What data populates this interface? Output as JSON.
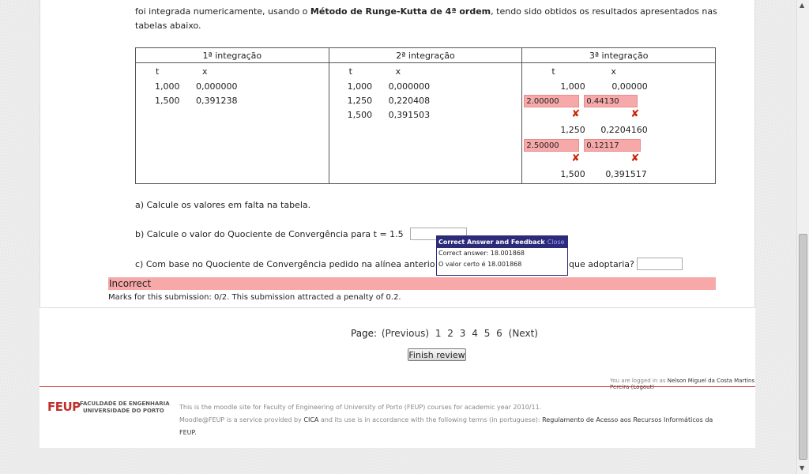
{
  "intro": {
    "part1": "foi integrada numericamente, usando o ",
    "method": "Método de Runge-Kutta de 4ª ordem",
    "part2": ", tendo sido obtidos os resultados apresentados nas",
    "line2": "tabelas abaixo."
  },
  "table": {
    "headers": [
      "1ª integração",
      "2ª integração",
      "3ª integração"
    ],
    "col_t": "t",
    "col_x": "x",
    "int1": [
      [
        "1,000",
        "0,000000"
      ],
      [
        "1,500",
        "0,391238"
      ]
    ],
    "int2": [
      [
        "1,000",
        "0,000000"
      ],
      [
        "1,250",
        "0,220408"
      ],
      [
        "1,500",
        "0,391503"
      ]
    ],
    "int3": {
      "row1": [
        "1,000",
        "0,00000"
      ],
      "input1": [
        "2.00000",
        "0.44130"
      ],
      "row2": [
        "1,250",
        "0,2204160"
      ],
      "input2": [
        "2.50000",
        "0.12117"
      ],
      "row3": [
        "1,500",
        "0,391517"
      ],
      "mark": "✘"
    }
  },
  "questions": {
    "a": "a) Calcule os valores em falta na tabela.",
    "b": "b) Calcule o valor do Quociente de Convergência para t = 1.5",
    "c_start": "c) Com base no Quociente de Convergência pedido na alínea anterio",
    "c_end": "que adoptaria?"
  },
  "tooltip": {
    "title": "Correct Answer and Feedback",
    "close": "Close",
    "line1": "Correct answer: 18.001868",
    "line2": "O valor certo é 18.001868"
  },
  "status": "Incorrect",
  "marks": "Marks for this submission: 0/2. This submission attracted a penalty of 0.2.",
  "pager": {
    "label": "Page:",
    "prev": "(Previous)",
    "pages": [
      "1",
      "2",
      "3",
      "4",
      "5",
      "6"
    ],
    "next": "(Next)"
  },
  "finish_button": "Finish review",
  "login": {
    "prefix": "You are logged in as ",
    "user": "Nelson Miguel da Costa Martins Pereira",
    "logout": "(Logout)"
  },
  "footer": {
    "logo": "FEUP",
    "logo_line1": "FACULDADE DE ENGENHARIA",
    "logo_line2": "UNIVERSIDADE DO PORTO",
    "line1": "This is the moodle site for Faculty of Engineering of University of Porto (FEUP) courses for academic year 2010/11.",
    "line2a": "Moodle@FEUP is a service provided by ",
    "cica": "CICA",
    "line2b": " and its use is in accordance with the following terms (in portuguese): ",
    "reg": "Regulamento de Acesso aos Recursos Informáticos da",
    "line3": "FEUP."
  }
}
